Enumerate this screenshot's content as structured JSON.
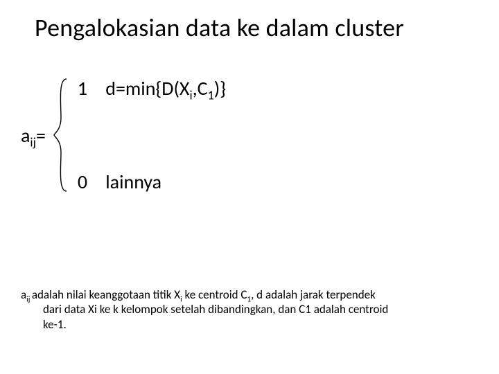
{
  "title": "Pengalokasian data ke dalam cluster",
  "equation": {
    "lhs_var": "a",
    "lhs_sub": "ij",
    "lhs_eq": "=",
    "cases": [
      {
        "value": "1",
        "cond_prefix": "d=min{D(X",
        "cond_sub1": "i",
        "cond_mid": ",C",
        "cond_sub2": "1",
        "cond_suffix": ")}"
      },
      {
        "value": "0",
        "cond": "lainnya"
      }
    ]
  },
  "footnote": {
    "p1a": "a",
    "p1a_sub": "ij ",
    "p1b": "adalah nilai keanggotaan titik X",
    "p1b_sub": "i",
    "p1c": " ke centroid C",
    "p1c_sub": "1",
    "p1d": ", d adalah jarak terpendek",
    "p2": "dari data Xi ke k kelompok setelah dibandingkan, dan C1 adalah centroid",
    "p3": "ke-1."
  }
}
